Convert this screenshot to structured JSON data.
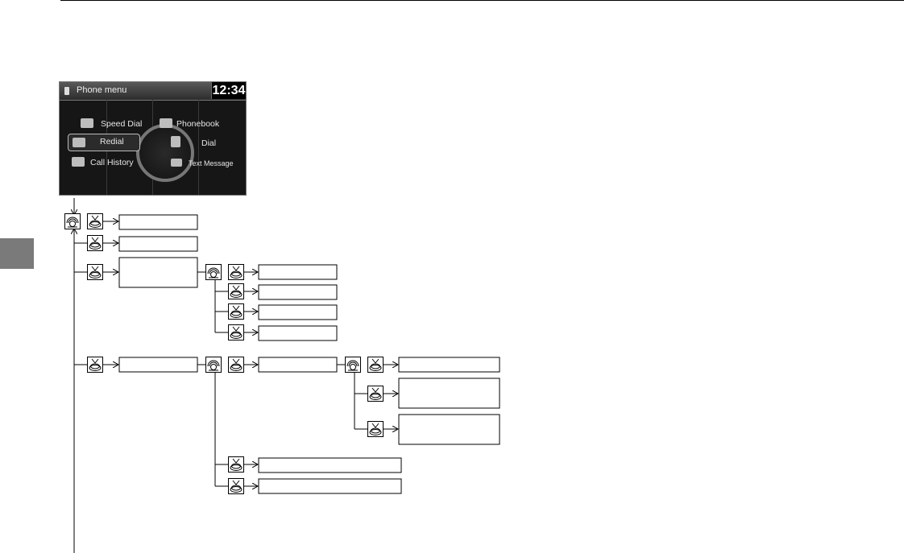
{
  "screen": {
    "title": "Phone menu",
    "clock": "12:34",
    "menu": {
      "speed_dial": "Speed Dial",
      "phonebook": "Phonebook",
      "redial": "Redial",
      "dial": "Dial",
      "call_history": "Call History",
      "text_message": "Text Message"
    }
  },
  "flow": {
    "interface_icons": [
      "rotate-icon",
      "press-icon"
    ],
    "box_count_note": ""
  },
  "colors": {
    "tab": "#7a7a7a",
    "screen_bg": "#161616",
    "line": "#000000"
  }
}
